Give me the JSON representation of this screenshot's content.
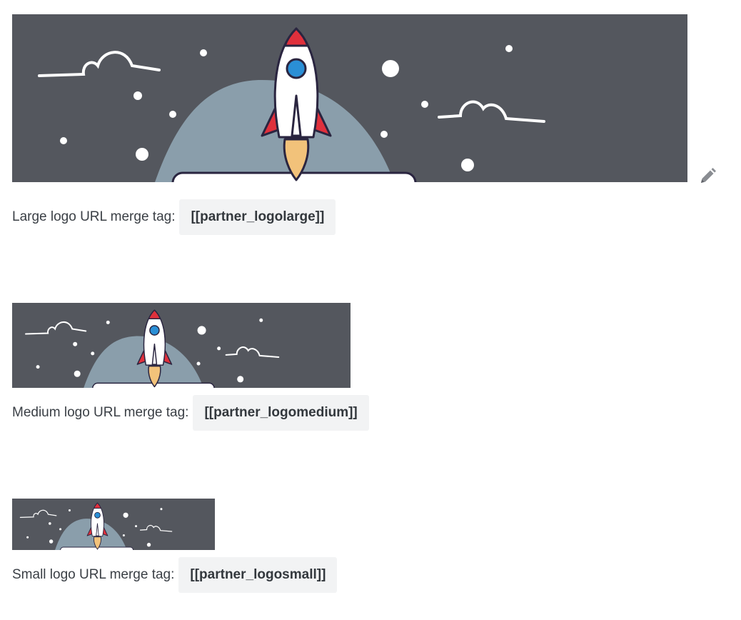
{
  "logos": {
    "large": {
      "label": "Large logo URL merge tag:",
      "tag": "[[partner_logolarge]]"
    },
    "medium": {
      "label": "Medium logo URL merge tag:",
      "tag": "[[partner_logomedium]]"
    },
    "small": {
      "label": "Small logo URL merge tag:",
      "tag": "[[partner_logosmall]]"
    }
  },
  "colors": {
    "banner_background": "#54575e",
    "hill": "#8a9eab",
    "rocket_body": "#ffffff",
    "rocket_fins": "#e0303c",
    "rocket_window": "#2a8fd6",
    "flame": "#f2c27a",
    "outline": "#2a2540",
    "merge_tag_background": "#f2f3f4"
  },
  "icons": {
    "edit": "pencil-icon",
    "banner_art": "rocket-illustration"
  }
}
